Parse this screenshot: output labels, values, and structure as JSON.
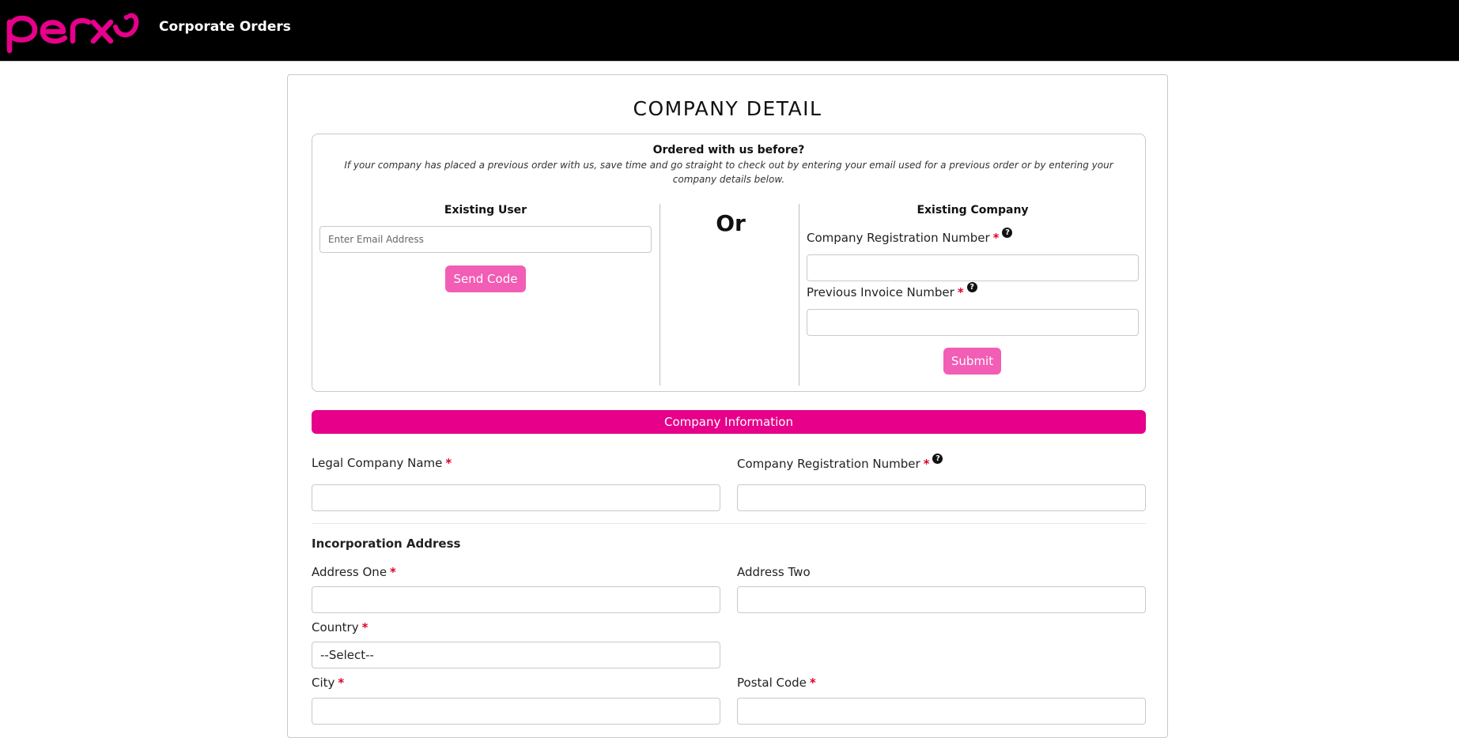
{
  "colors": {
    "brand_pink": "#e6008a",
    "button_pink": "#f25db5",
    "header_bg": "#000000"
  },
  "header": {
    "logo_text": "perx",
    "title": "Corporate Orders"
  },
  "page": {
    "title": "COMPANY DETAIL"
  },
  "previous_order": {
    "heading": "Ordered with us before?",
    "note": "If your company has placed a previous order with us, save time and go straight to check out by entering your email used for a previous order or by entering your company details below.",
    "existing_user": {
      "title": "Existing User",
      "email_placeholder": "Enter Email Address",
      "email_value": "",
      "send_code_label": "Send Code"
    },
    "or_label": "Or",
    "existing_company": {
      "title": "Existing Company",
      "reg_number_label": "Company Registration Number",
      "reg_number_value": "",
      "invoice_label": "Previous Invoice Number",
      "invoice_value": "",
      "submit_label": "Submit"
    },
    "required_mark": "*",
    "help_icon": "?"
  },
  "company_info": {
    "section_title": "Company Information",
    "legal_name_label": "Legal Company Name",
    "legal_name_value": "",
    "reg_number_label": "Company Registration Number",
    "reg_number_value": ""
  },
  "incorporation_address": {
    "heading": "Incorporation Address",
    "address_one_label": "Address One",
    "address_one_value": "",
    "address_two_label": "Address Two",
    "address_two_value": "",
    "country_label": "Country",
    "country_selected": "--Select--",
    "city_label": "City",
    "city_value": "",
    "postal_code_label": "Postal Code",
    "postal_code_value": ""
  }
}
